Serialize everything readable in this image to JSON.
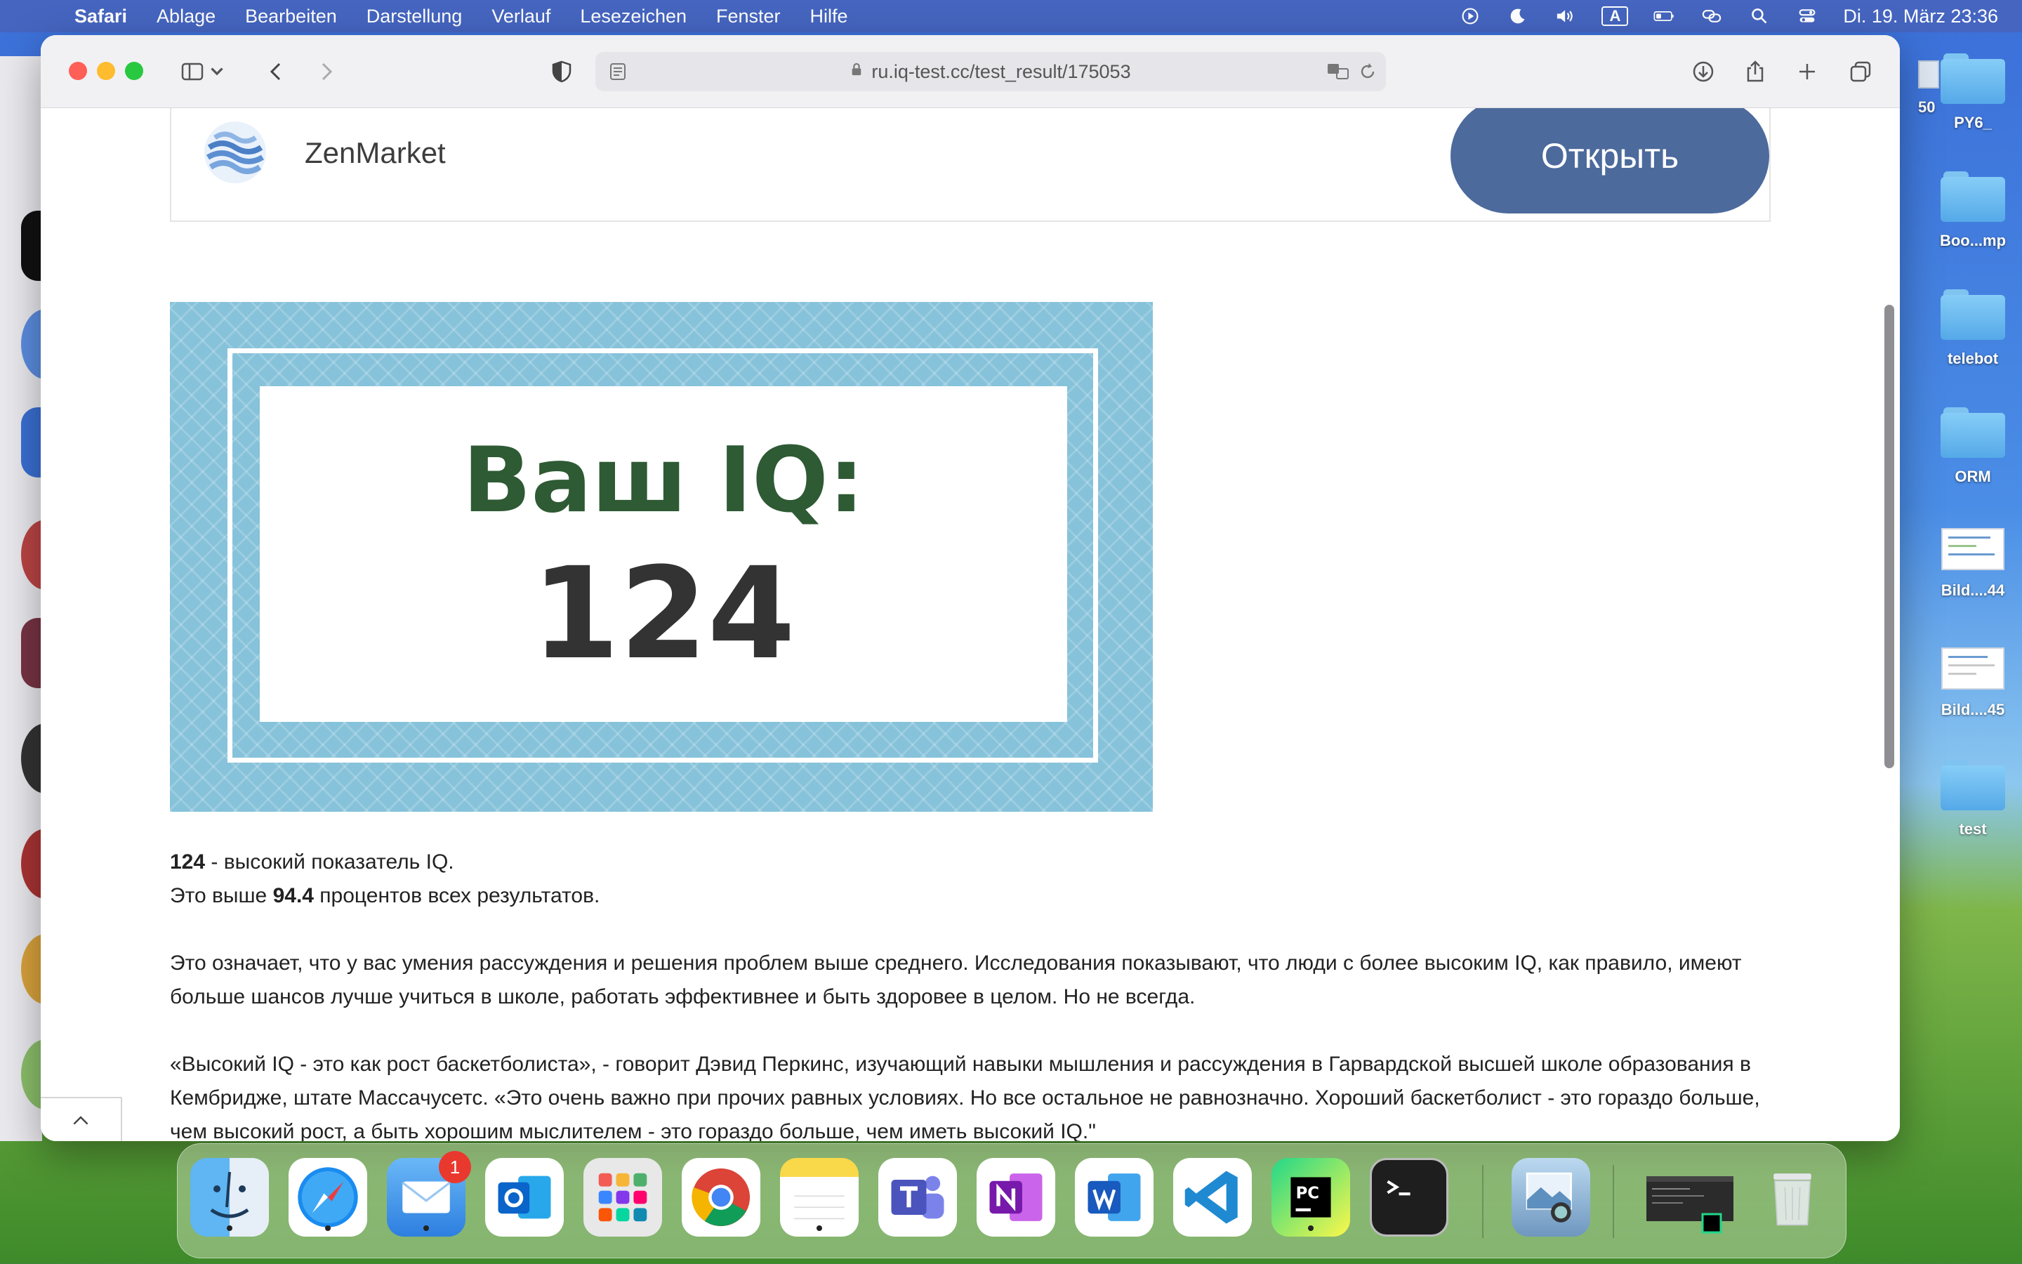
{
  "menubar": {
    "app_name": "Safari",
    "items": [
      "Ablage",
      "Bearbeiten",
      "Darstellung",
      "Verlauf",
      "Lesezeichen",
      "Fenster",
      "Hilfe"
    ],
    "keyboard_layout": "A",
    "clock": "Di. 19. März  23:36"
  },
  "browser": {
    "url": "ru.iq-test.cc/test_result/175053"
  },
  "ad": {
    "name": "ZenMarket",
    "button_label": "Открыть"
  },
  "result_image": {
    "title": "Ваш IQ:",
    "score": "124"
  },
  "result_text": {
    "score_bold": "124",
    "score_suffix": " - высокий показатель IQ.",
    "percent_prefix": "Это выше ",
    "percent_bold": "94.4",
    "percent_suffix": " процентов всех результатов.",
    "paragraph1": "Это означает, что у вас умения рассуждения и решения проблем выше среднего. Исследования показывают, что люди с более высоким IQ, как правило, имеют больше шансов лучше учиться в школе, работать эффективнее и быть здоровее в целом. Но не всегда.",
    "paragraph2": "«Высокий IQ - это как рост баскетболиста», - говорит Дэвид Перкинс, изучающий навыки мышления и рассуждения в Гарвардской высшей школе образования в Кембридже, штате Массачусетс. «Это очень важно при прочих равных условиях. Но все остальное не равнозначно. Хороший баскетболист - это гораздо больше, чем высокий рост, а быть хорошим мыслителем - это гораздо больше, чем иметь высокий IQ.\""
  },
  "desktop": {
    "items": [
      {
        "label": "PY6_",
        "kind": "folder"
      },
      {
        "label": "Boo...mp",
        "kind": "folder"
      },
      {
        "label": "telebot",
        "kind": "folder"
      },
      {
        "label": "ORM",
        "kind": "folder"
      },
      {
        "label": "Bild....44",
        "kind": "image"
      },
      {
        "label": "Bild....45",
        "kind": "image"
      },
      {
        "label": "test",
        "kind": "folder"
      }
    ],
    "partial_label": "50"
  },
  "dock": {
    "mail_badge": "1",
    "apps": [
      "Finder",
      "Safari",
      "Mail",
      "Outlook",
      "Launchpad",
      "Chrome",
      "Notes",
      "Teams",
      "OneNote",
      "Word",
      "VS Code",
      "PyCharm",
      "Terminal",
      "Preview",
      "Recent window",
      "Trash"
    ]
  }
}
